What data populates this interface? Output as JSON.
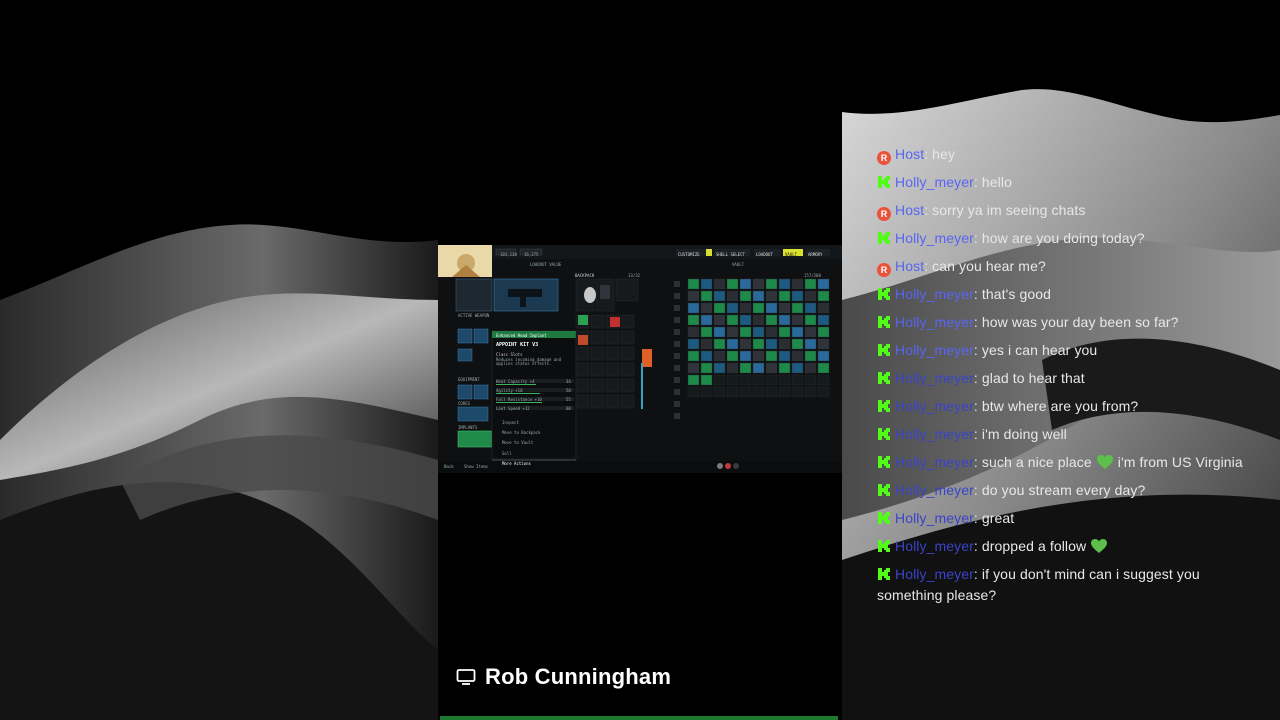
{
  "game": {
    "currency_a": "103,130",
    "currency_b": "16,275",
    "nav": [
      "CUSTOMIZE",
      "SHELL SELECT",
      "LOADOUT",
      "VAULT",
      "ARMORY"
    ],
    "loadout_value": "LOADOUT VALUE",
    "vault_value": "VAULT",
    "backpack_label": "BACKPACK",
    "backpack_count": "13/32",
    "vault_count": "157/200",
    "weapon_label": "ACTIVE WEAPON",
    "equipment_label": "EQUIPMENT",
    "cores_label": "CORES",
    "implants_label": "IMPLANTS",
    "tooltip": {
      "header": "Enhanced Head Implant",
      "title": "APPOINT KIT V3",
      "subtitle": "Class Slots",
      "desc": "Reduces incoming damage and applies status effects.",
      "stats": [
        {
          "label": "Heat Capacity +4",
          "value": "34"
        },
        {
          "label": "Agility +10",
          "value": "50"
        },
        {
          "label": "Fall Resistance +10",
          "value": "55"
        },
        {
          "label": "Loot Speed +12",
          "value": "60"
        }
      ],
      "actions": [
        "Inspect",
        "Move to Backpack",
        "Move to Vault",
        "Sell",
        "More Actions"
      ]
    },
    "footer_left": [
      "Back",
      "Show Items"
    ]
  },
  "chat": {
    "messages": [
      {
        "badge": "R",
        "user": "Host",
        "text": "hey",
        "dim": false
      },
      {
        "badge": "K",
        "user": "Holly_meyer",
        "text": "hello",
        "dim": false
      },
      {
        "badge": "R",
        "user": "Host",
        "text": "sorry ya im seeing chats",
        "dim": false
      },
      {
        "badge": "K",
        "user": "Holly_meyer",
        "text": "how are you doing today?",
        "dim": false
      },
      {
        "badge": "R",
        "user": "Host",
        "text": "can you hear me?",
        "dim": false
      },
      {
        "badge": "K",
        "user": "Holly_meyer",
        "text": "that's good",
        "dim": false
      },
      {
        "badge": "K",
        "user": "Holly_meyer",
        "text": "how was your day been so far?",
        "dim": false
      },
      {
        "badge": "K",
        "user": "Holly_meyer",
        "text": "yes i can hear you",
        "dim": false
      },
      {
        "badge": "K",
        "user": "Holly_meyer",
        "text": "glad to hear that",
        "dim": true
      },
      {
        "badge": "K",
        "user": "Holly_meyer",
        "text": "btw where are you from?",
        "dim": true
      },
      {
        "badge": "K",
        "user": "Holly_meyer",
        "text": "i'm doing well",
        "dim": true
      },
      {
        "badge": "K",
        "user": "Holly_meyer",
        "text": "such a nice place",
        "text2": "i'm from US Virginia",
        "heart": true,
        "dim": true
      },
      {
        "badge": "K",
        "user": "Holly_meyer",
        "text": "do you stream every day?",
        "dim": true
      },
      {
        "badge": "K",
        "user": "Holly_meyer",
        "text": "great",
        "dim": true
      },
      {
        "badge": "K",
        "user": "Holly_meyer",
        "text": "dropped a follow",
        "heartEnd": true,
        "dim": true
      },
      {
        "badge": "K",
        "user": "Holly_meyer",
        "text": "if you don't mind can i suggest you something please?",
        "dim": true
      }
    ]
  },
  "streamer": {
    "name": "Rob Cunningham"
  },
  "colors": {
    "host_badge": "#e8533a",
    "kick_green": "#53fc18",
    "username": "#5865f2",
    "heart": "#5cc04a"
  }
}
